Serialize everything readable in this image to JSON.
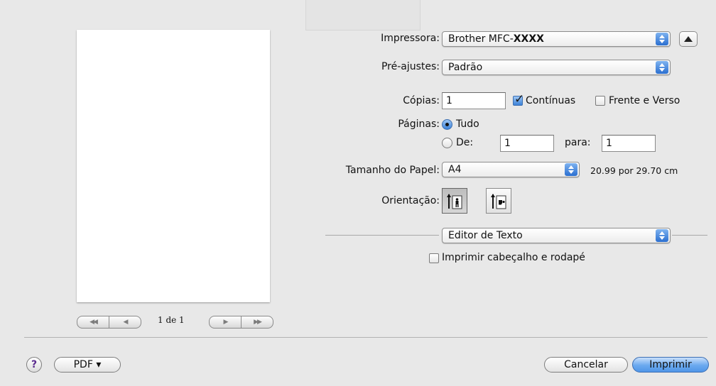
{
  "printer": {
    "label": "Impressora:",
    "value_prefix": "Brother MFC-",
    "value_bold": "XXXX"
  },
  "presets": {
    "label": "Pré-ajustes:",
    "value": "Padrão"
  },
  "copies": {
    "label": "Cópias:",
    "value": "1",
    "collated_label": "Contínuas",
    "collated_checked": true,
    "duplex_label": "Frente e Verso",
    "duplex_checked": false
  },
  "pages": {
    "label": "Páginas:",
    "all_label": "Tudo",
    "from_label": "De:",
    "from_value": "1",
    "to_label": "para:",
    "to_value": "1",
    "selected": "all"
  },
  "paper_size": {
    "label": "Tamanho do Papel:",
    "value": "A4",
    "dimensions": "20.99 por 29.70 cm"
  },
  "orientation": {
    "label": "Orientação:",
    "options": [
      "portrait-icon",
      "landscape-icon"
    ],
    "selected": "portrait"
  },
  "section": {
    "value": "Editor de Texto",
    "header_footer_label": "Imprimir cabeçalho e rodapé",
    "header_footer_checked": false
  },
  "preview": {
    "page_indicator": "1 de 1",
    "nav_first": "◀◀",
    "nav_prev": "◀",
    "nav_next": "▶",
    "nav_last": "▶▶"
  },
  "footer": {
    "help_label": "?",
    "pdf_label": "PDF ▾",
    "cancel_label": "Cancelar",
    "print_label": "Imprimir"
  },
  "colors": {
    "accent": "#4f96e8",
    "background": "#e8e8e8",
    "help_icon": "#5b2c8e"
  }
}
